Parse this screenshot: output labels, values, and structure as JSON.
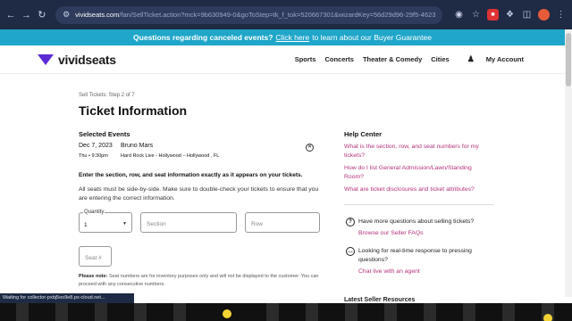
{
  "browser": {
    "url_domain": "vividseats.com",
    "url_rest": "/fan/SellTicket.action?mck=9b630949-0&goToStep=tk_f_tok=520667301&wizardKey=56d29d96-29f5-4623-a644-455df5081327&stepNumber=2",
    "status": "Waiting for collector-pxbj5oo9e8.px-cloud.net..."
  },
  "announcement": {
    "text": "Questions regarding canceled events?",
    "link": "Click here",
    "rest": "to learn about our Buyer Guarantee"
  },
  "header": {
    "logo": "vividseats",
    "nav": [
      "Sports",
      "Concerts",
      "Theater & Comedy",
      "Cities"
    ],
    "account": "My Account"
  },
  "main": {
    "step": "Sell Tickets: Step 2 of 7",
    "title": "Ticket Information",
    "selected_events_heading": "Selected Events",
    "event": {
      "date": "Dec 7, 2023",
      "time": "Thu • 9:30pm",
      "name": "Bruno Mars",
      "venue": "Hard Rock Live - Hollywood – Hollywood , FL"
    },
    "instruction": "Enter the section, row, and seat information exactly as it appears on your tickets.",
    "paragraph": "All seats must be side-by-side. Make sure to double-check your tickets to ensure that you are entering the correct information.",
    "quantity_label": "Quantity",
    "quantity_value": "1",
    "section_placeholder": "Section",
    "row_placeholder": "Row",
    "seat_placeholder": "Seat #",
    "note_label": "Please note:",
    "note_text": "Seat numbers are for inventory purposes only and will not be displayed to the customer. You can proceed with any consecutive numbers."
  },
  "help": {
    "heading": "Help Center",
    "links": [
      "What is the section, row, and seat numbers for my tickets?",
      "How do I list General Admission/Lawn/Standing Room?",
      "What are ticket disclosures and ticket attributes?"
    ],
    "faq_text": "Have more questions about selling tickets?",
    "faq_link": "Browse our Seller FAQs",
    "chat_text": "Looking for real-time response to pressing questions?",
    "chat_link": "Chat live with an agent",
    "peek_text": "Latest Seller Resources"
  }
}
